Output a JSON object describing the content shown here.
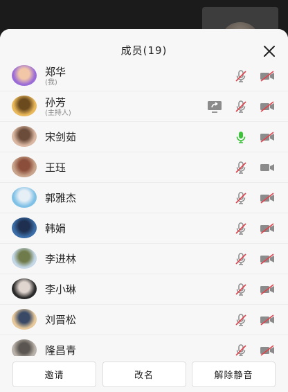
{
  "panel": {
    "title": "成员(19)"
  },
  "colors": {
    "muted": "#e0424b",
    "active_mic": "#3ec23a",
    "icon": "#8b8b8b"
  },
  "members": [
    {
      "name": "郑华",
      "role": "(我)",
      "avatar": [
        "#9b6bd8",
        "#f2c7a7"
      ],
      "screen_share": false,
      "mic": "muted",
      "camera": "muted"
    },
    {
      "name": "孙芳",
      "role": "(主持人)",
      "avatar": [
        "#e9b85a",
        "#6b4a1e"
      ],
      "screen_share": true,
      "mic": "muted",
      "camera": "muted"
    },
    {
      "name": "宋剑茹",
      "role": "",
      "avatar": [
        "#d9b7a2",
        "#6b4b3a"
      ],
      "screen_share": false,
      "mic": "active",
      "camera": "muted"
    },
    {
      "name": "王珏",
      "role": "",
      "avatar": [
        "#c9a48c",
        "#8b4e3a"
      ],
      "screen_share": false,
      "mic": "muted",
      "camera": "on"
    },
    {
      "name": "郭雅杰",
      "role": "",
      "avatar": [
        "#7ec0e6",
        "#e7eff6"
      ],
      "screen_share": false,
      "mic": "muted",
      "camera": "muted"
    },
    {
      "name": "韩娟",
      "role": "",
      "avatar": [
        "#3b6ea8",
        "#1e2f4f"
      ],
      "screen_share": false,
      "mic": "muted",
      "camera": "muted"
    },
    {
      "name": "李进林",
      "role": "",
      "avatar": [
        "#c3d7e6",
        "#6f7b4a"
      ],
      "screen_share": false,
      "mic": "muted",
      "camera": "muted"
    },
    {
      "name": "李小琳",
      "role": "",
      "avatar": [
        "#2a2a2a",
        "#e0d5cf"
      ],
      "screen_share": false,
      "mic": "muted",
      "camera": "muted"
    },
    {
      "name": "刘晋松",
      "role": "",
      "avatar": [
        "#e6c89a",
        "#3a4a66"
      ],
      "screen_share": false,
      "mic": "muted",
      "camera": "muted"
    },
    {
      "name": "隆昌青",
      "role": "",
      "avatar": [
        "#b9b2aa",
        "#5a5550"
      ],
      "screen_share": false,
      "mic": "muted",
      "camera": "muted"
    }
  ],
  "footer": {
    "invite": "邀请",
    "rename": "改名",
    "unmute": "解除静音"
  },
  "icons": {
    "close": "close-icon",
    "mic": "microphone-icon",
    "camera": "camera-icon",
    "share": "screen-share-icon"
  }
}
